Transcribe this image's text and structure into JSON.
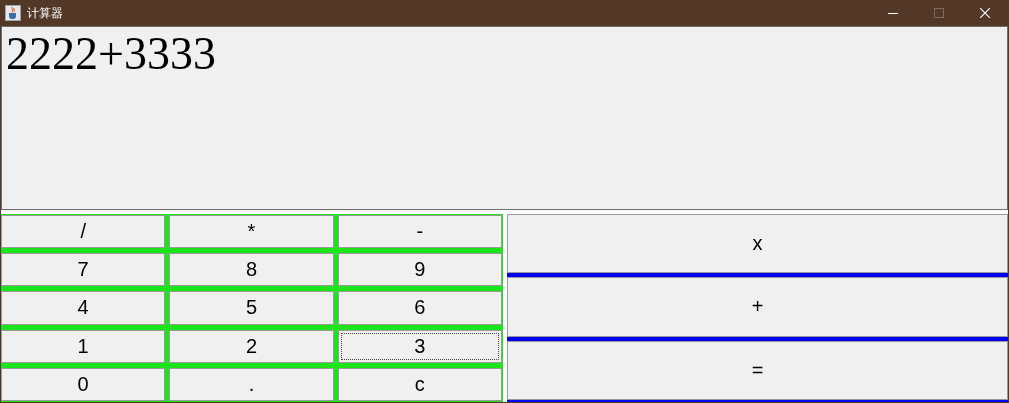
{
  "window": {
    "title": "计算器",
    "controls": [
      {
        "kind": "minimize",
        "disabled": false
      },
      {
        "kind": "maximize",
        "disabled": true
      },
      {
        "kind": "close",
        "disabled": false
      }
    ]
  },
  "display": {
    "value": "2222+3333"
  },
  "keypad": [
    {
      "label": "/",
      "focused": false
    },
    {
      "label": "*",
      "focused": false
    },
    {
      "label": "-",
      "focused": false
    },
    {
      "label": "7",
      "focused": false
    },
    {
      "label": "8",
      "focused": false
    },
    {
      "label": "9",
      "focused": false
    },
    {
      "label": "4",
      "focused": false
    },
    {
      "label": "5",
      "focused": false
    },
    {
      "label": "6",
      "focused": false
    },
    {
      "label": "1",
      "focused": false
    },
    {
      "label": "2",
      "focused": false
    },
    {
      "label": "3",
      "focused": true
    },
    {
      "label": "0",
      "focused": false
    },
    {
      "label": ".",
      "focused": false
    },
    {
      "label": "c",
      "focused": false
    }
  ],
  "operators": [
    {
      "label": "x"
    },
    {
      "label": "+"
    },
    {
      "label": "="
    }
  ]
}
